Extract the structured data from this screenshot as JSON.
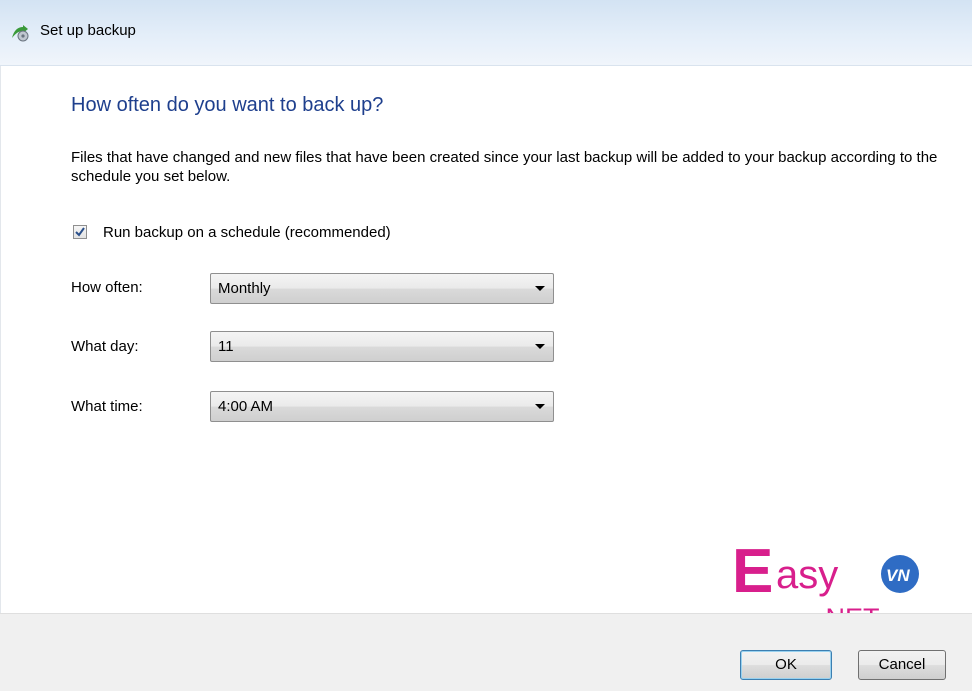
{
  "window": {
    "title": "Set up backup"
  },
  "heading": "How often do you want to back up?",
  "description": "Files that have changed and new files that have been created since your last backup will be added to your backup according to the schedule you set below.",
  "schedule_checkbox": {
    "label": "Run backup on a schedule (recommended)",
    "checked": true
  },
  "fields": [
    {
      "label": "How often:",
      "value": "Monthly"
    },
    {
      "label": "What day:",
      "value": "11"
    },
    {
      "label": "What time:",
      "value": "4:00 AM"
    }
  ],
  "watermark": {
    "logo_letter": "E",
    "logo_text": "asy",
    "badge": "VN",
    "suffix": ".NET"
  },
  "buttons": {
    "ok": "OK",
    "cancel": "Cancel"
  },
  "colors": {
    "heading": "#1e3f8d",
    "logo_pink": "#d81f8c",
    "logo_blue": "#2f6cc4"
  }
}
